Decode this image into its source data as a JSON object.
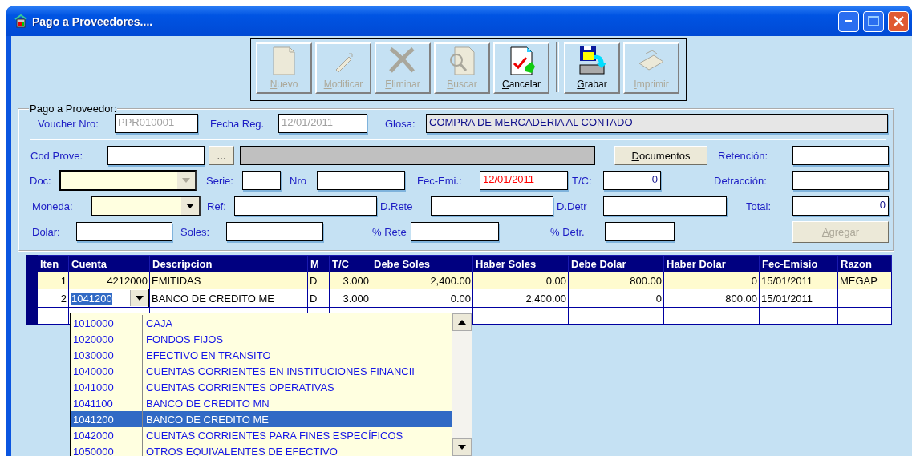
{
  "window": {
    "title": "Pago a Proveedores...."
  },
  "toolbar": {
    "buttons": [
      {
        "label": "Nuevo",
        "disabled": true,
        "separator_before": false
      },
      {
        "label": "Modificar",
        "disabled": true,
        "separator_before": false
      },
      {
        "label": "Eliminar",
        "disabled": true,
        "separator_before": false
      },
      {
        "label": "Buscar",
        "disabled": true,
        "separator_before": false
      },
      {
        "label": "Cancelar",
        "disabled": false,
        "separator_before": false
      },
      {
        "label": "Grabar",
        "disabled": false,
        "separator_before": true
      },
      {
        "label": "Imprimir",
        "disabled": true,
        "separator_before": false
      }
    ]
  },
  "form": {
    "legend": "Pago a Proveedor:",
    "rows": [
      {
        "items": [
          {
            "kind": "label",
            "text": "Voucher Nro:"
          },
          {
            "kind": "input",
            "value": "PPR010001",
            "disabled": true
          },
          {
            "kind": "label",
            "text": "Fecha Reg."
          },
          {
            "kind": "input",
            "value": "12/01/2011",
            "disabled": true
          },
          {
            "kind": "label",
            "text": "Glosa:"
          },
          {
            "kind": "input",
            "value": "COMPRA DE MERCADERIA AL CONTADO",
            "readonly": true
          }
        ]
      },
      {
        "items": [
          {
            "kind": "label",
            "text": "Cod.Prove:"
          },
          {
            "kind": "input"
          },
          {
            "kind": "button",
            "text": "..."
          },
          {
            "kind": "display"
          },
          {
            "kind": "button",
            "text": "Documentos"
          },
          {
            "kind": "label",
            "text": "Retención:"
          },
          {
            "kind": "input"
          }
        ]
      },
      {
        "items": [
          {
            "kind": "label",
            "text": "Doc:"
          },
          {
            "kind": "combo",
            "disabled": true
          },
          {
            "kind": "label",
            "text": "Serie:"
          },
          {
            "kind": "input"
          },
          {
            "kind": "label",
            "text": "Nro"
          },
          {
            "kind": "input"
          },
          {
            "kind": "label",
            "text": "Fec-Emi.:"
          },
          {
            "kind": "input",
            "value": "12/01/2011",
            "highlighted": true
          },
          {
            "kind": "label",
            "text": "T/C:"
          },
          {
            "kind": "number",
            "value": "0"
          },
          {
            "kind": "label",
            "text": "Detracción:"
          },
          {
            "kind": "input"
          }
        ]
      },
      {
        "items": [
          {
            "kind": "label",
            "text": "Moneda:"
          },
          {
            "kind": "combo",
            "disabled": false
          },
          {
            "kind": "label",
            "text": "Ref:"
          },
          {
            "kind": "input"
          },
          {
            "kind": "label",
            "text": "D.Rete"
          },
          {
            "kind": "input"
          },
          {
            "kind": "label",
            "text": "D.Detr"
          },
          {
            "kind": "input"
          },
          {
            "kind": "label",
            "text": "Total:"
          },
          {
            "kind": "number",
            "value": "0"
          }
        ]
      },
      {
        "items": [
          {
            "kind": "label",
            "text": "Dolar:"
          },
          {
            "kind": "input"
          },
          {
            "kind": "label",
            "text": "Soles:"
          },
          {
            "kind": "input"
          },
          {
            "kind": "label",
            "text": "% Rete"
          },
          {
            "kind": "input"
          },
          {
            "kind": "label",
            "text": "% Detr."
          },
          {
            "kind": "input"
          },
          {
            "kind": "button",
            "text": "Agregar",
            "disabled": true
          }
        ]
      }
    ]
  },
  "grid": {
    "columns": [
      "Iten",
      "Cuenta",
      "Descripcion",
      "M",
      "T/C",
      "Debe Soles",
      "Haber Soles",
      "Debe Dolar",
      "Haber Dolar",
      "Fec-Emisio",
      "Razon"
    ],
    "rows": [
      {
        "selected": true,
        "editing": false,
        "cells": [
          "1",
          "4212000",
          "EMITIDAS",
          "D",
          "3.000",
          "2,400.00",
          "0.00",
          "800.00",
          "0",
          "15/01/2011",
          "MEGAP"
        ]
      },
      {
        "selected": false,
        "editing": true,
        "cells": [
          "2",
          "1041200",
          "BANCO DE CREDITO ME",
          "D",
          "3.000",
          "0.00",
          "2,400.00",
          "0",
          "800.00",
          "15/01/2011"
        ]
      }
    ]
  },
  "dropdown": {
    "items": [
      {
        "code": "1010000",
        "name": "CAJA",
        "selected": false
      },
      {
        "code": "1020000",
        "name": "FONDOS FIJOS",
        "selected": false
      },
      {
        "code": "1030000",
        "name": "EFECTIVO EN TRANSITO",
        "selected": false
      },
      {
        "code": "1040000",
        "name": "CUENTAS CORRIENTES EN INSTITUCIONES FINANCII",
        "selected": false
      },
      {
        "code": "1041000",
        "name": "CUENTAS CORRIENTES OPERATIVAS",
        "selected": false
      },
      {
        "code": "1041100",
        "name": "BANCO DE CREDITO MN",
        "selected": false
      },
      {
        "code": "1041200",
        "name": "BANCO DE CREDITO ME",
        "selected": true
      },
      {
        "code": "1042000",
        "name": "CUENTAS CORRIENTES PARA FINES ESPECÍFICOS",
        "selected": false
      },
      {
        "code": "1050000",
        "name": "OTROS EQUIVALENTES DE EFECTIVO",
        "selected": false
      }
    ]
  }
}
